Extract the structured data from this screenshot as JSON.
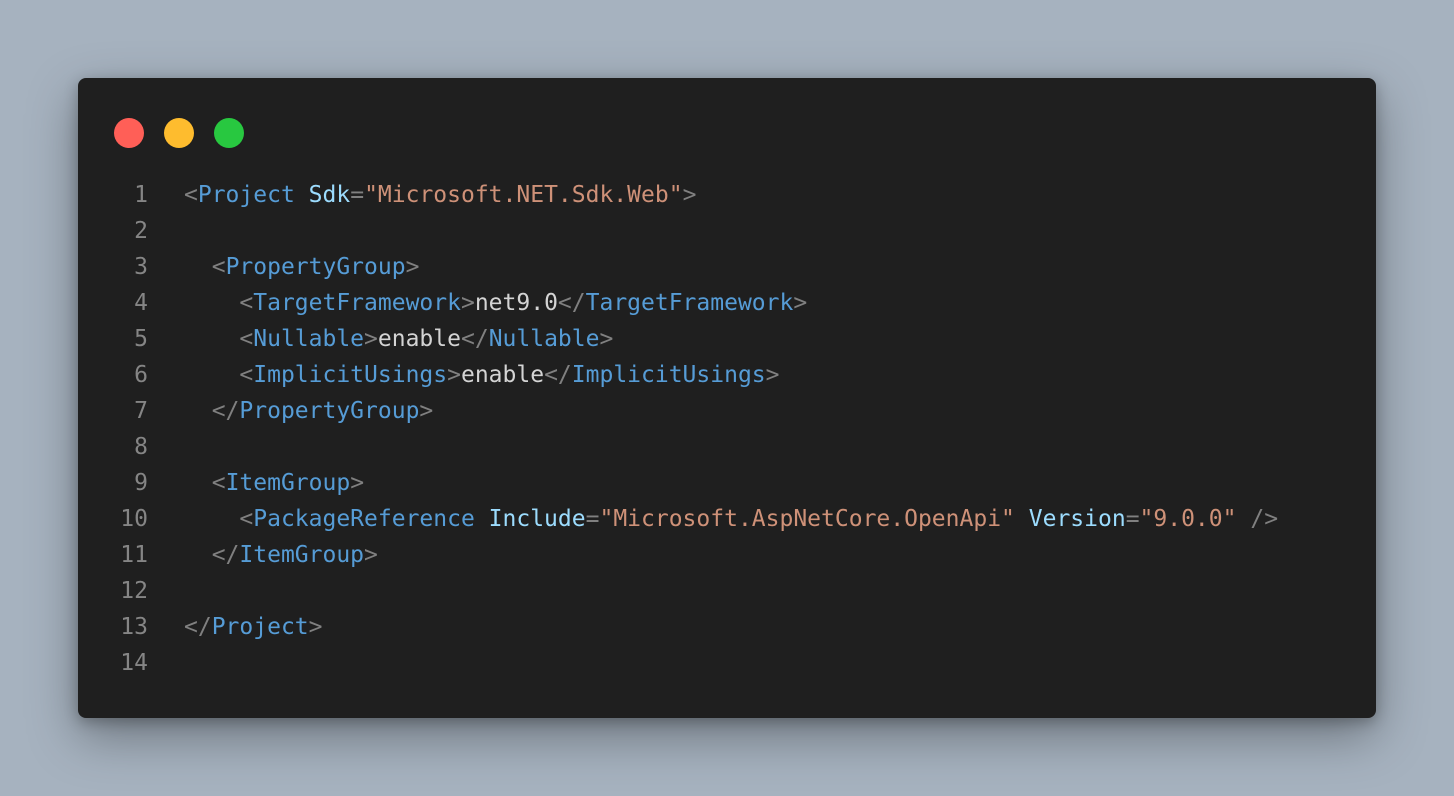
{
  "window": {
    "traffic_lights": [
      {
        "name": "close",
        "color": "#ff5f57"
      },
      {
        "name": "minimize",
        "color": "#febc2e"
      },
      {
        "name": "zoom",
        "color": "#28c840"
      }
    ]
  },
  "theme": {
    "background": "#1f1f1f",
    "punctuation": "#808080",
    "tag": "#569cd6",
    "attribute": "#9cdcfe",
    "string": "#ce9178",
    "text": "#d4d4d4",
    "line_number": "#858585"
  },
  "code": {
    "lines": [
      {
        "num": "1",
        "indent": "",
        "tokens": [
          {
            "t": "<",
            "c": "p"
          },
          {
            "t": "Project",
            "c": "t"
          },
          {
            "t": " ",
            "c": "x"
          },
          {
            "t": "Sdk",
            "c": "a"
          },
          {
            "t": "=",
            "c": "p"
          },
          {
            "t": "\"Microsoft.NET.Sdk.Web\"",
            "c": "s"
          },
          {
            "t": ">",
            "c": "p"
          }
        ]
      },
      {
        "num": "2",
        "indent": "",
        "tokens": []
      },
      {
        "num": "3",
        "indent": "  ",
        "tokens": [
          {
            "t": "<",
            "c": "p"
          },
          {
            "t": "PropertyGroup",
            "c": "t"
          },
          {
            "t": ">",
            "c": "p"
          }
        ]
      },
      {
        "num": "4",
        "indent": "    ",
        "tokens": [
          {
            "t": "<",
            "c": "p"
          },
          {
            "t": "TargetFramework",
            "c": "t"
          },
          {
            "t": ">",
            "c": "p"
          },
          {
            "t": "net9.0",
            "c": "x"
          },
          {
            "t": "</",
            "c": "p"
          },
          {
            "t": "TargetFramework",
            "c": "t"
          },
          {
            "t": ">",
            "c": "p"
          }
        ]
      },
      {
        "num": "5",
        "indent": "    ",
        "tokens": [
          {
            "t": "<",
            "c": "p"
          },
          {
            "t": "Nullable",
            "c": "t"
          },
          {
            "t": ">",
            "c": "p"
          },
          {
            "t": "enable",
            "c": "x"
          },
          {
            "t": "</",
            "c": "p"
          },
          {
            "t": "Nullable",
            "c": "t"
          },
          {
            "t": ">",
            "c": "p"
          }
        ]
      },
      {
        "num": "6",
        "indent": "    ",
        "tokens": [
          {
            "t": "<",
            "c": "p"
          },
          {
            "t": "ImplicitUsings",
            "c": "t"
          },
          {
            "t": ">",
            "c": "p"
          },
          {
            "t": "enable",
            "c": "x"
          },
          {
            "t": "</",
            "c": "p"
          },
          {
            "t": "ImplicitUsings",
            "c": "t"
          },
          {
            "t": ">",
            "c": "p"
          }
        ]
      },
      {
        "num": "7",
        "indent": "  ",
        "tokens": [
          {
            "t": "</",
            "c": "p"
          },
          {
            "t": "PropertyGroup",
            "c": "t"
          },
          {
            "t": ">",
            "c": "p"
          }
        ]
      },
      {
        "num": "8",
        "indent": "",
        "tokens": []
      },
      {
        "num": "9",
        "indent": "  ",
        "tokens": [
          {
            "t": "<",
            "c": "p"
          },
          {
            "t": "ItemGroup",
            "c": "t"
          },
          {
            "t": ">",
            "c": "p"
          }
        ]
      },
      {
        "num": "10",
        "indent": "    ",
        "tokens": [
          {
            "t": "<",
            "c": "p"
          },
          {
            "t": "PackageReference",
            "c": "t"
          },
          {
            "t": " ",
            "c": "x"
          },
          {
            "t": "Include",
            "c": "a"
          },
          {
            "t": "=",
            "c": "p"
          },
          {
            "t": "\"Microsoft.AspNetCore.OpenApi\"",
            "c": "s"
          },
          {
            "t": " ",
            "c": "x"
          },
          {
            "t": "Version",
            "c": "a"
          },
          {
            "t": "=",
            "c": "p"
          },
          {
            "t": "\"9.0.0\"",
            "c": "s"
          },
          {
            "t": " ",
            "c": "x"
          },
          {
            "t": "/>",
            "c": "p"
          }
        ]
      },
      {
        "num": "11",
        "indent": "  ",
        "tokens": [
          {
            "t": "</",
            "c": "p"
          },
          {
            "t": "ItemGroup",
            "c": "t"
          },
          {
            "t": ">",
            "c": "p"
          }
        ]
      },
      {
        "num": "12",
        "indent": "",
        "tokens": []
      },
      {
        "num": "13",
        "indent": "",
        "tokens": [
          {
            "t": "</",
            "c": "p"
          },
          {
            "t": "Project",
            "c": "t"
          },
          {
            "t": ">",
            "c": "p"
          }
        ]
      },
      {
        "num": "14",
        "indent": "",
        "tokens": []
      }
    ]
  }
}
